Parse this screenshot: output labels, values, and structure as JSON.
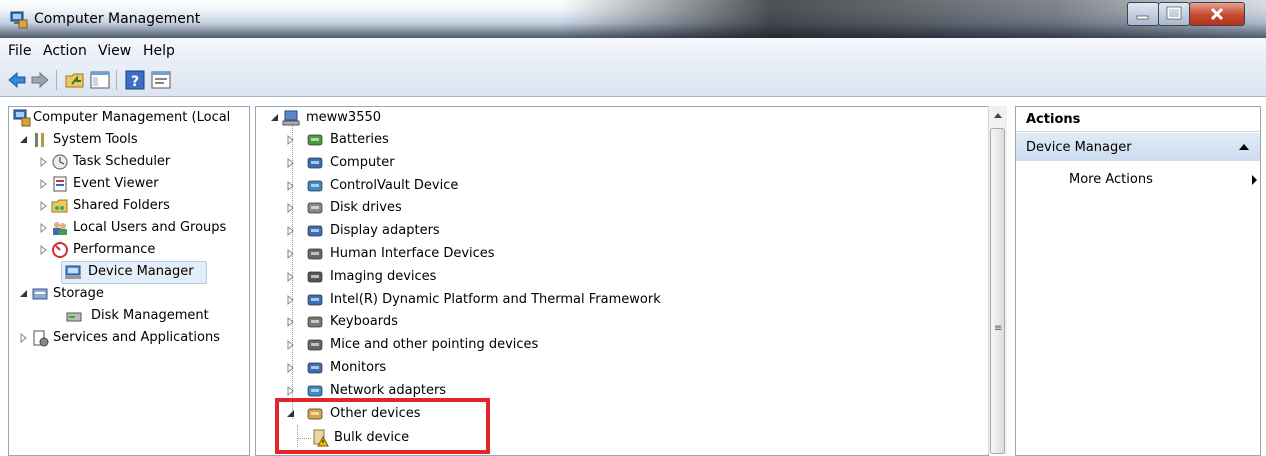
{
  "window": {
    "title": "Computer Management"
  },
  "menu": [
    "File",
    "Action",
    "View",
    "Help"
  ],
  "toolbar_icons": [
    "back-arrow-icon",
    "forward-arrow-icon",
    "up-folder-icon",
    "show-hide-console-tree-icon",
    "help-icon",
    "properties-icon"
  ],
  "tree": {
    "root": "Computer Management (Local",
    "system_tools": "System Tools",
    "task_scheduler": "Task Scheduler",
    "event_viewer": "Event Viewer",
    "shared_folders": "Shared Folders",
    "local_users": "Local Users and Groups",
    "performance": "Performance",
    "device_manager": "Device Manager",
    "storage": "Storage",
    "disk_management": "Disk Management",
    "services": "Services and Applications"
  },
  "devices": {
    "computer_name": "meww3550",
    "categories": [
      "Batteries",
      "Computer",
      "ControlVault Device",
      "Disk drives",
      "Display adapters",
      "Human Interface Devices",
      "Imaging devices",
      "Intel(R) Dynamic Platform and Thermal Framework",
      "Keyboards",
      "Mice and other pointing devices",
      "Monitors",
      "Network adapters",
      "Other devices"
    ],
    "other_child": "Bulk device"
  },
  "actions": {
    "header": "Actions",
    "section": "Device Manager",
    "more": "More Actions"
  },
  "colors": {
    "highlight": "#e0262b",
    "accent": "#cddcef"
  }
}
